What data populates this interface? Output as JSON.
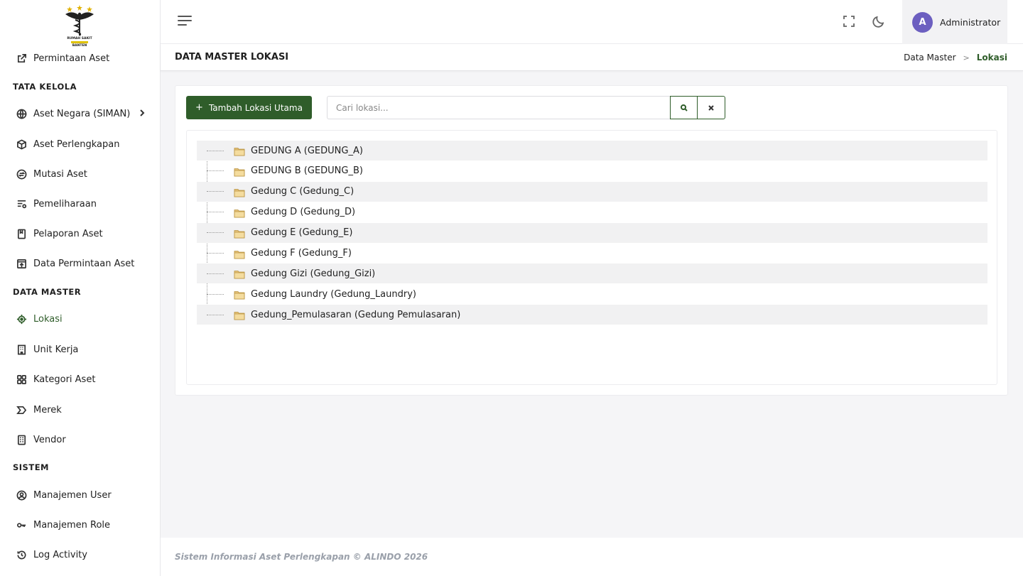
{
  "sidebar": {
    "logo_lines": [
      "RUMAH SAKIT",
      "BANTEN"
    ],
    "items_top": [
      {
        "label": "Permintaan Aset",
        "icon": "external-link-icon"
      }
    ],
    "sections": [
      {
        "label": "TATA KELOLA"
      },
      {
        "label": "DATA MASTER"
      },
      {
        "label": "SISTEM"
      }
    ],
    "tata_kelola": [
      {
        "label": "Aset Negara (SIMAN)",
        "icon": "globe-icon"
      },
      {
        "label": "Aset Perlengkapan",
        "icon": "box-icon"
      },
      {
        "label": "Mutasi Aset",
        "icon": "transfer-icon"
      },
      {
        "label": "Pemeliharaan",
        "icon": "maintenance-icon"
      },
      {
        "label": "Pelaporan Aset",
        "icon": "report-icon"
      },
      {
        "label": "Data Permintaan Aset",
        "icon": "inbox-icon"
      }
    ],
    "data_master": [
      {
        "label": "Lokasi",
        "icon": "location-icon"
      },
      {
        "label": "Unit Kerja",
        "icon": "building-icon"
      },
      {
        "label": "Kategori Aset",
        "icon": "grid-icon"
      },
      {
        "label": "Merek",
        "icon": "tag-icon"
      },
      {
        "label": "Vendor",
        "icon": "vendor-icon"
      }
    ],
    "sistem": [
      {
        "label": "Manajemen User",
        "icon": "user-circle-icon"
      },
      {
        "label": "Manajemen Role",
        "icon": "key-icon"
      },
      {
        "label": "Log Activity",
        "icon": "history-icon"
      }
    ]
  },
  "header": {
    "user_initial": "A",
    "user_name": "Administrator"
  },
  "page": {
    "title": "DATA MASTER LOKASI",
    "breadcrumb": [
      "Data Master",
      "Lokasi"
    ]
  },
  "toolbar": {
    "add_label": "Tambah Lokasi Utama",
    "search_placeholder": "Cari lokasi..."
  },
  "tree": [
    "GEDUNG A (GEDUNG_A)",
    "GEDUNG B (GEDUNG_B)",
    "Gedung C (Gedung_C)",
    "Gedung D (Gedung_D)",
    "Gedung E (Gedung_E)",
    "Gedung F (Gedung_F)",
    "Gedung Gizi (Gedung_Gizi)",
    "Gedung Laundry (Gedung_Laundry)",
    "Gedung_Pemulasaran (Gedung Pemulasaran)"
  ],
  "footer": {
    "text": "Sistem Informasi Aset Perlengkapan © ALINDO 2026"
  },
  "colors": {
    "accent": "#2f5d2a",
    "avatar": "#6c5fc0"
  }
}
